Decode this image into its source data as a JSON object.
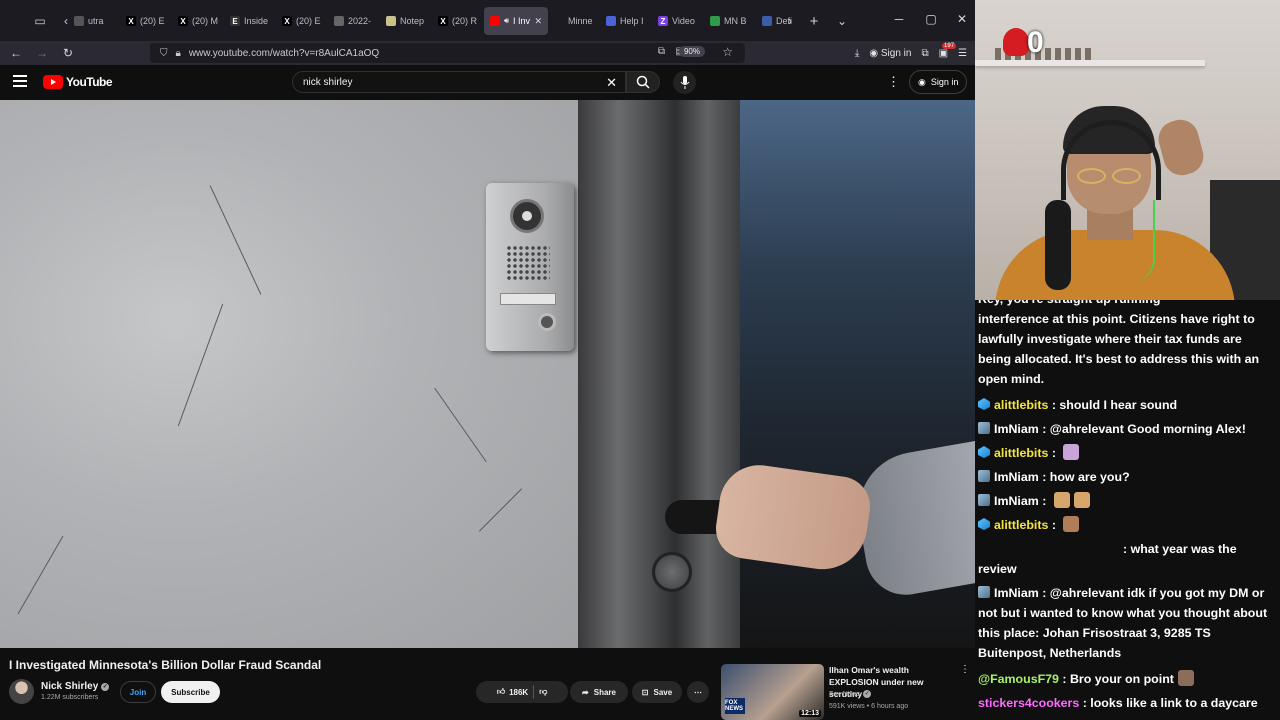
{
  "browser": {
    "tabs": [
      {
        "label": "utra",
        "fav": "",
        "favColor": "#555555"
      },
      {
        "label": "(20) E",
        "fav": "X",
        "favColor": "#000000"
      },
      {
        "label": "(20) M",
        "fav": "X",
        "favColor": "#000000"
      },
      {
        "label": "Inside",
        "fav": "E",
        "favColor": "#333333"
      },
      {
        "label": "(20) E",
        "fav": "X",
        "favColor": "#000000"
      },
      {
        "label": "2022-",
        "fav": "",
        "favColor": "#666666"
      },
      {
        "label": "Notep",
        "fav": "",
        "favColor": "#c9c38a"
      },
      {
        "label": "(20) R",
        "fav": "X",
        "favColor": "#000000"
      },
      {
        "label": "I Inv",
        "fav": "",
        "favColor": "#ff0000",
        "active": true
      },
      {
        "label": "Minne",
        "fav": "",
        "favColor": "#1c1b22"
      },
      {
        "label": "Help I",
        "fav": "",
        "favColor": "#4a63d8"
      },
      {
        "label": "Video",
        "fav": "Z",
        "favColor": "#7b3fe4"
      },
      {
        "label": "MN B",
        "fav": "",
        "favColor": "#2e9d47"
      },
      {
        "label": "Defi",
        "fav": "",
        "favColor": "#3a5fa8"
      }
    ],
    "url": "www.youtube.com/watch?v=r8AulCA1aOQ",
    "zoom": "90%",
    "signin_label": "Sign in",
    "ext_badge": "197"
  },
  "youtube": {
    "logo_text": "YouTube",
    "search_value": "nick shirley",
    "signin_label": "Sign in",
    "video": {
      "title": "I Investigated Minnesota's Billion Dollar Fraud Scandal",
      "channel": "Nick Shirley",
      "subscribers": "1.22M subscribers",
      "join_label": "Join",
      "subscribe_label": "Subscribe",
      "likes": "186K",
      "share_label": "Share",
      "save_label": "Save"
    },
    "recommended": {
      "title": "Ilhan Omar's wealth EXPLOSION under new scrutiny",
      "channel": "Fox News",
      "meta": "591K views • 6 hours ago",
      "duration": "12:13",
      "badge": "FOX NEWS"
    }
  },
  "stream": {
    "viewer_count": "0",
    "chat": [
      {
        "user": "",
        "text": "Rey, you're straight up running",
        "cut": true
      },
      {
        "user": "",
        "text": "interference at this point. Citizens have right to lawfully investigate where their tax funds are being allocated. It's best to address this with an open mind."
      },
      {
        "user": "alittlebits",
        "userColor": "yellow",
        "icon": "blue",
        "text": " : should I hear sound"
      },
      {
        "user": "ImNiam",
        "userColor": "",
        "icon": "steel",
        "text": " : @ahrelevant Good morning Alex!"
      },
      {
        "user": "alittlebits",
        "userColor": "yellow",
        "icon": "blue",
        "text": " : ",
        "emotes": [
          "#c9a4d8"
        ]
      },
      {
        "user": "ImNiam",
        "userColor": "",
        "icon": "steel",
        "text": " : how are you?"
      },
      {
        "user": "ImNiam",
        "userColor": "",
        "icon": "steel",
        "text": " : ",
        "emotes": [
          "#d7a66b",
          "#d7a66b"
        ]
      },
      {
        "user": "alittlebits",
        "userColor": "yellow",
        "icon": "blue",
        "text": " : ",
        "emotes": [
          "#b07c5a"
        ]
      },
      {
        "user": "",
        "text": ": what year was the review",
        "indent": true
      },
      {
        "user": "ImNiam",
        "userColor": "",
        "icon": "steel",
        "text": " : @ahrelevant idk if you got my DM or not but i wanted to know what you thought about this place: Johan Frisostraat 3, 9285 TS Buitenpost, Netherlands"
      },
      {
        "user": "@FamousF79",
        "userColor": "green",
        "icon": "",
        "text": " : Bro your on point",
        "emotes": [
          "#8a6d5a"
        ]
      },
      {
        "user": "stickers4cookers",
        "userColor": "fuchsia",
        "icon": "",
        "text": " : looks like a link to a daycare"
      }
    ]
  }
}
